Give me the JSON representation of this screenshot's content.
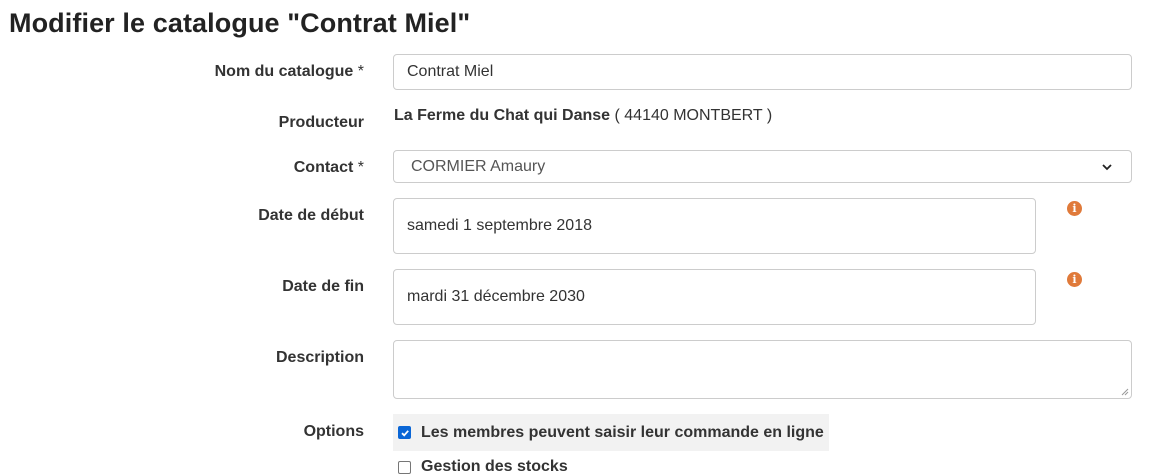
{
  "page": {
    "title": "Modifier le catalogue \"Contrat Miel\""
  },
  "form": {
    "catalog_name": {
      "label": "Nom du catalogue",
      "required_mark": "*",
      "value": "Contrat Miel"
    },
    "producer": {
      "label": "Producteur",
      "name": "La Ferme du Chat qui Danse",
      "location": "( 44140 MONTBERT )"
    },
    "contact": {
      "label": "Contact",
      "required_mark": "*",
      "value": "CORMIER Amaury"
    },
    "start_date": {
      "label": "Date de début",
      "value": "samedi 1 septembre 2018",
      "info_icon": "info-icon"
    },
    "end_date": {
      "label": "Date de fin",
      "value": "mardi 31 décembre 2030",
      "info_icon": "info-icon"
    },
    "description": {
      "label": "Description",
      "value": ""
    },
    "options": {
      "label": "Options",
      "items": [
        {
          "label": "Les membres peuvent saisir leur commande en ligne",
          "checked": true
        },
        {
          "label": "Gestion des stocks",
          "checked": false
        }
      ]
    }
  },
  "colors": {
    "accent_checkbox": "#0a66d6",
    "info_icon": "#e07a3a",
    "highlight_row": "#f2f2f2"
  }
}
